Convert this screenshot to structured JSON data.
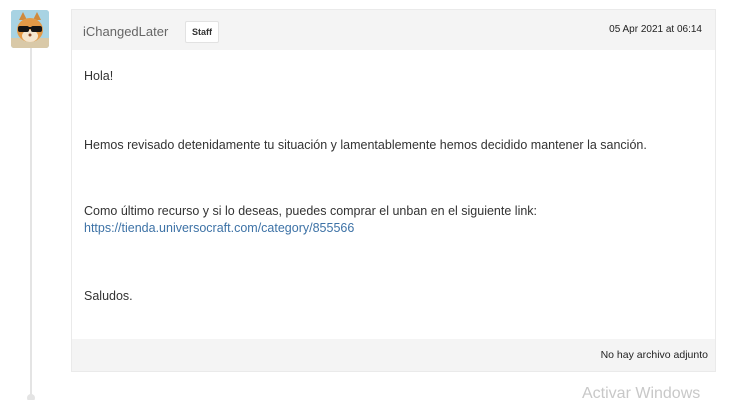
{
  "post": {
    "author": "iChangedLater",
    "role_badge": "Staff",
    "timestamp": "05 Apr 2021 at 06:14",
    "message": {
      "greeting": "Hola!",
      "paragraph_1": "Hemos revisado detenidamente tu situación y lamentablemente hemos decidido mantener la sanción.",
      "paragraph_2": "Como último recurso y si lo deseas, puedes comprar el unban en el siguiente link:",
      "link": "https://tienda.universocraft.com/category/855566",
      "closing": "Saludos."
    },
    "attachments_note": "No hay archivo adjunto"
  },
  "watermark": "Activar Windows",
  "colors": {
    "header_bg": "#f4f4f4",
    "link": "#3d72a6",
    "thread_line": "#e4e4e4"
  }
}
